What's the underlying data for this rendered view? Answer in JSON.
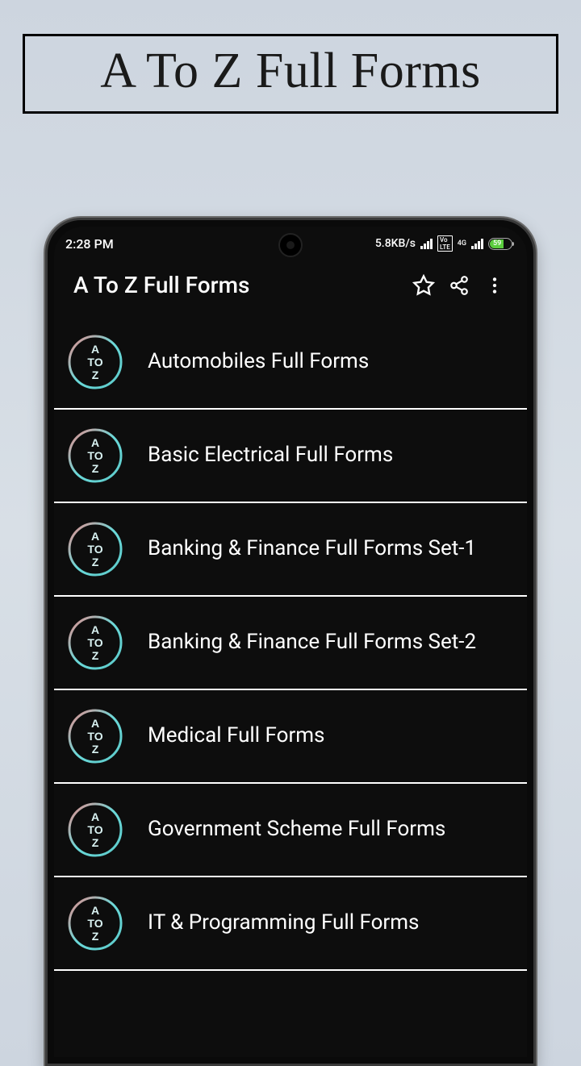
{
  "banner": {
    "title": "A To Z Full Forms"
  },
  "status": {
    "time": "2:28 PM",
    "speed": "5.8KB/s",
    "network": "4G",
    "volte": "Vo\nLTE",
    "battery": "59"
  },
  "appbar": {
    "title": "A To Z Full Forms"
  },
  "icon": {
    "line1": "A",
    "line2": "TO",
    "line3": "Z"
  },
  "list": {
    "items": [
      {
        "label": "Automobiles Full Forms"
      },
      {
        "label": "Basic Electrical Full Forms"
      },
      {
        "label": "Banking & Finance Full Forms Set-1"
      },
      {
        "label": "Banking & Finance Full Forms Set-2"
      },
      {
        "label": "Medical Full Forms"
      },
      {
        "label": "Government Scheme Full Forms"
      },
      {
        "label": "IT & Programming Full Forms"
      }
    ]
  }
}
